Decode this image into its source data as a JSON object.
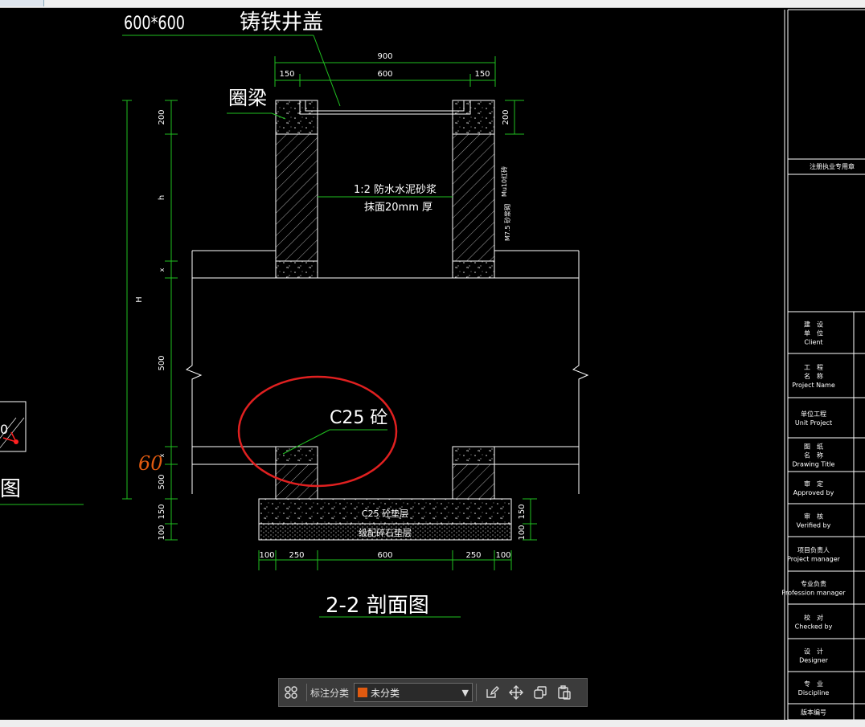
{
  "drawing": {
    "cover_size": "600*600",
    "cover_label": "铸铁井盖",
    "ring_beam_label": "圈梁",
    "plaster_line1": "1:2  防水水泥砂浆",
    "plaster_line2": "抹面20mm  厚",
    "wall_note1": "Mu10红砖",
    "wall_note2": "M7.5 砂浆砌",
    "concrete_label": "C25   砼",
    "cushion_label": "C25 砼垫层",
    "gravel_label": "级配碎石垫层",
    "handwritten": "60",
    "section_title": "2-2   剖面图",
    "left_partial_title": "图",
    "left_partial_num": "0",
    "dims": {
      "top_total": "900",
      "top_left": "150",
      "top_mid": "600",
      "top_right": "150",
      "right_top": "200",
      "left_200": "200",
      "left_h": "h",
      "left_x": "x",
      "left_H": "H",
      "left_500a": "500",
      "left_x2": "x",
      "left_500b": "500",
      "left_150": "150",
      "left_100": "100",
      "right_150": "150",
      "right_100": "100",
      "bot_100a": "100",
      "bot_250a": "250",
      "bot_600": "600",
      "bot_250b": "250",
      "bot_100b": "100"
    }
  },
  "title_block": {
    "stamp": "注册执业专用章",
    "rows": [
      {
        "cn": "建　设\n单　位",
        "en": "Client"
      },
      {
        "cn": "工　程\n名　称",
        "en": "Project Name"
      },
      {
        "cn": "单位工程",
        "en": "Unit Project"
      },
      {
        "cn": "图　纸\n名　称",
        "en": "Drawing Title"
      },
      {
        "cn": "审　定",
        "en": "Approved by"
      },
      {
        "cn": "审　核",
        "en": "Verified by"
      },
      {
        "cn": "项目负责人",
        "en": "Project manager"
      },
      {
        "cn": "专业负责",
        "en": "Profession manager"
      },
      {
        "cn": "校　对",
        "en": "Checked by"
      },
      {
        "cn": "设　计",
        "en": "Designer"
      },
      {
        "cn": "专　业",
        "en": "Discipline"
      },
      {
        "cn": "版本编号",
        "en": ""
      }
    ]
  },
  "toolbar": {
    "category_label": "标注分类",
    "category_value": "未分类",
    "category_color": "#e05a10"
  }
}
